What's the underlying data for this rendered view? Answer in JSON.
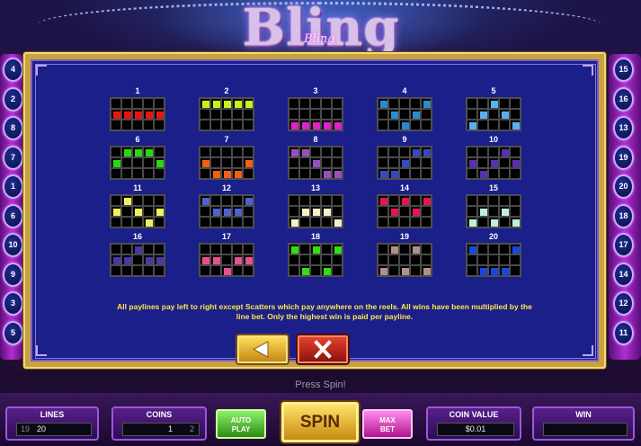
{
  "logo": {
    "main": "Bling",
    "sub": "Bling"
  },
  "left_pills": [
    "4",
    "2",
    "8",
    "7",
    "1",
    "6",
    "10",
    "9",
    "3",
    "5"
  ],
  "right_pills": [
    "15",
    "16",
    "13",
    "19",
    "20",
    "18",
    "17",
    "14",
    "12",
    "11"
  ],
  "paylines": [
    {
      "n": "1",
      "color": "#e81414",
      "cells": [
        [
          1,
          0
        ],
        [
          1,
          1
        ],
        [
          1,
          2
        ],
        [
          1,
          3
        ],
        [
          1,
          4
        ]
      ]
    },
    {
      "n": "2",
      "color": "#c8f020",
      "cells": [
        [
          0,
          0
        ],
        [
          0,
          1
        ],
        [
          0,
          2
        ],
        [
          0,
          3
        ],
        [
          0,
          4
        ]
      ]
    },
    {
      "n": "3",
      "color": "#e020c8",
      "cells": [
        [
          2,
          0
        ],
        [
          2,
          1
        ],
        [
          2,
          2
        ],
        [
          2,
          3
        ],
        [
          2,
          4
        ]
      ]
    },
    {
      "n": "4",
      "color": "#2a8ad0",
      "cells": [
        [
          0,
          0
        ],
        [
          1,
          1
        ],
        [
          2,
          2
        ],
        [
          1,
          3
        ],
        [
          0,
          4
        ]
      ]
    },
    {
      "n": "5",
      "color": "#58b0f0",
      "cells": [
        [
          2,
          0
        ],
        [
          1,
          1
        ],
        [
          0,
          2
        ],
        [
          1,
          3
        ],
        [
          2,
          4
        ]
      ]
    },
    {
      "n": "6",
      "color": "#28d814",
      "cells": [
        [
          1,
          0
        ],
        [
          0,
          1
        ],
        [
          0,
          2
        ],
        [
          0,
          3
        ],
        [
          1,
          4
        ]
      ]
    },
    {
      "n": "7",
      "color": "#f06010",
      "cells": [
        [
          1,
          0
        ],
        [
          2,
          1
        ],
        [
          2,
          2
        ],
        [
          2,
          3
        ],
        [
          1,
          4
        ]
      ]
    },
    {
      "n": "8",
      "color": "#9850c0",
      "cells": [
        [
          0,
          0
        ],
        [
          0,
          1
        ],
        [
          1,
          2
        ],
        [
          2,
          3
        ],
        [
          2,
          4
        ]
      ]
    },
    {
      "n": "9",
      "color": "#3848c0",
      "cells": [
        [
          2,
          0
        ],
        [
          2,
          1
        ],
        [
          1,
          2
        ],
        [
          0,
          3
        ],
        [
          0,
          4
        ]
      ]
    },
    {
      "n": "10",
      "color": "#5830b0",
      "cells": [
        [
          1,
          0
        ],
        [
          2,
          1
        ],
        [
          1,
          2
        ],
        [
          0,
          3
        ],
        [
          1,
          4
        ]
      ]
    },
    {
      "n": "11",
      "color": "#f0f060",
      "cells": [
        [
          1,
          0
        ],
        [
          0,
          1
        ],
        [
          1,
          2
        ],
        [
          2,
          3
        ],
        [
          1,
          4
        ]
      ]
    },
    {
      "n": "12",
      "color": "#5060d0",
      "cells": [
        [
          0,
          0
        ],
        [
          1,
          1
        ],
        [
          1,
          2
        ],
        [
          1,
          3
        ],
        [
          0,
          4
        ]
      ]
    },
    {
      "n": "13",
      "color": "#f4f0c8",
      "cells": [
        [
          2,
          0
        ],
        [
          1,
          1
        ],
        [
          1,
          2
        ],
        [
          1,
          3
        ],
        [
          2,
          4
        ]
      ]
    },
    {
      "n": "14",
      "color": "#e81450",
      "cells": [
        [
          0,
          0
        ],
        [
          1,
          1
        ],
        [
          0,
          2
        ],
        [
          1,
          3
        ],
        [
          0,
          4
        ]
      ]
    },
    {
      "n": "15",
      "color": "#c0f0d8",
      "cells": [
        [
          2,
          0
        ],
        [
          1,
          1
        ],
        [
          2,
          2
        ],
        [
          1,
          3
        ],
        [
          2,
          4
        ]
      ]
    },
    {
      "n": "16",
      "color": "#4838a8",
      "cells": [
        [
          1,
          0
        ],
        [
          1,
          1
        ],
        [
          0,
          2
        ],
        [
          1,
          3
        ],
        [
          1,
          4
        ]
      ]
    },
    {
      "n": "17",
      "color": "#e85090",
      "cells": [
        [
          1,
          0
        ],
        [
          1,
          1
        ],
        [
          2,
          2
        ],
        [
          1,
          3
        ],
        [
          1,
          4
        ]
      ]
    },
    {
      "n": "18",
      "color": "#30e010",
      "cells": [
        [
          0,
          0
        ],
        [
          2,
          1
        ],
        [
          0,
          2
        ],
        [
          2,
          3
        ],
        [
          0,
          4
        ]
      ]
    },
    {
      "n": "19",
      "color": "#b09088",
      "cells": [
        [
          2,
          0
        ],
        [
          0,
          1
        ],
        [
          2,
          2
        ],
        [
          0,
          3
        ],
        [
          2,
          4
        ]
      ]
    },
    {
      "n": "20",
      "color": "#1848e0",
      "cells": [
        [
          0,
          0
        ],
        [
          2,
          1
        ],
        [
          2,
          2
        ],
        [
          2,
          3
        ],
        [
          0,
          4
        ]
      ]
    }
  ],
  "rules_line1": "All paylines pay left to right except Scatters which pay anywhere on the reels. All wins have been multiplied by the",
  "rules_line2": "line bet. Only the highest win is paid per payline.",
  "buttons": {
    "back_icon": "arrow-left-icon",
    "close_icon": "close-icon"
  },
  "status": "Press Spin!",
  "bottom": {
    "lines_label": "LINES",
    "lines_prev": "19",
    "lines_value": "20",
    "coins_label": "COINS",
    "coins_value": "1",
    "coins_next": "2",
    "autoplay": "AUTO PLAY",
    "spin": "SPIN",
    "maxbet": "MAX BET",
    "coin_value_label": "COIN VALUE",
    "coin_value": "$0.01",
    "win_label": "WIN",
    "win_value": ""
  }
}
